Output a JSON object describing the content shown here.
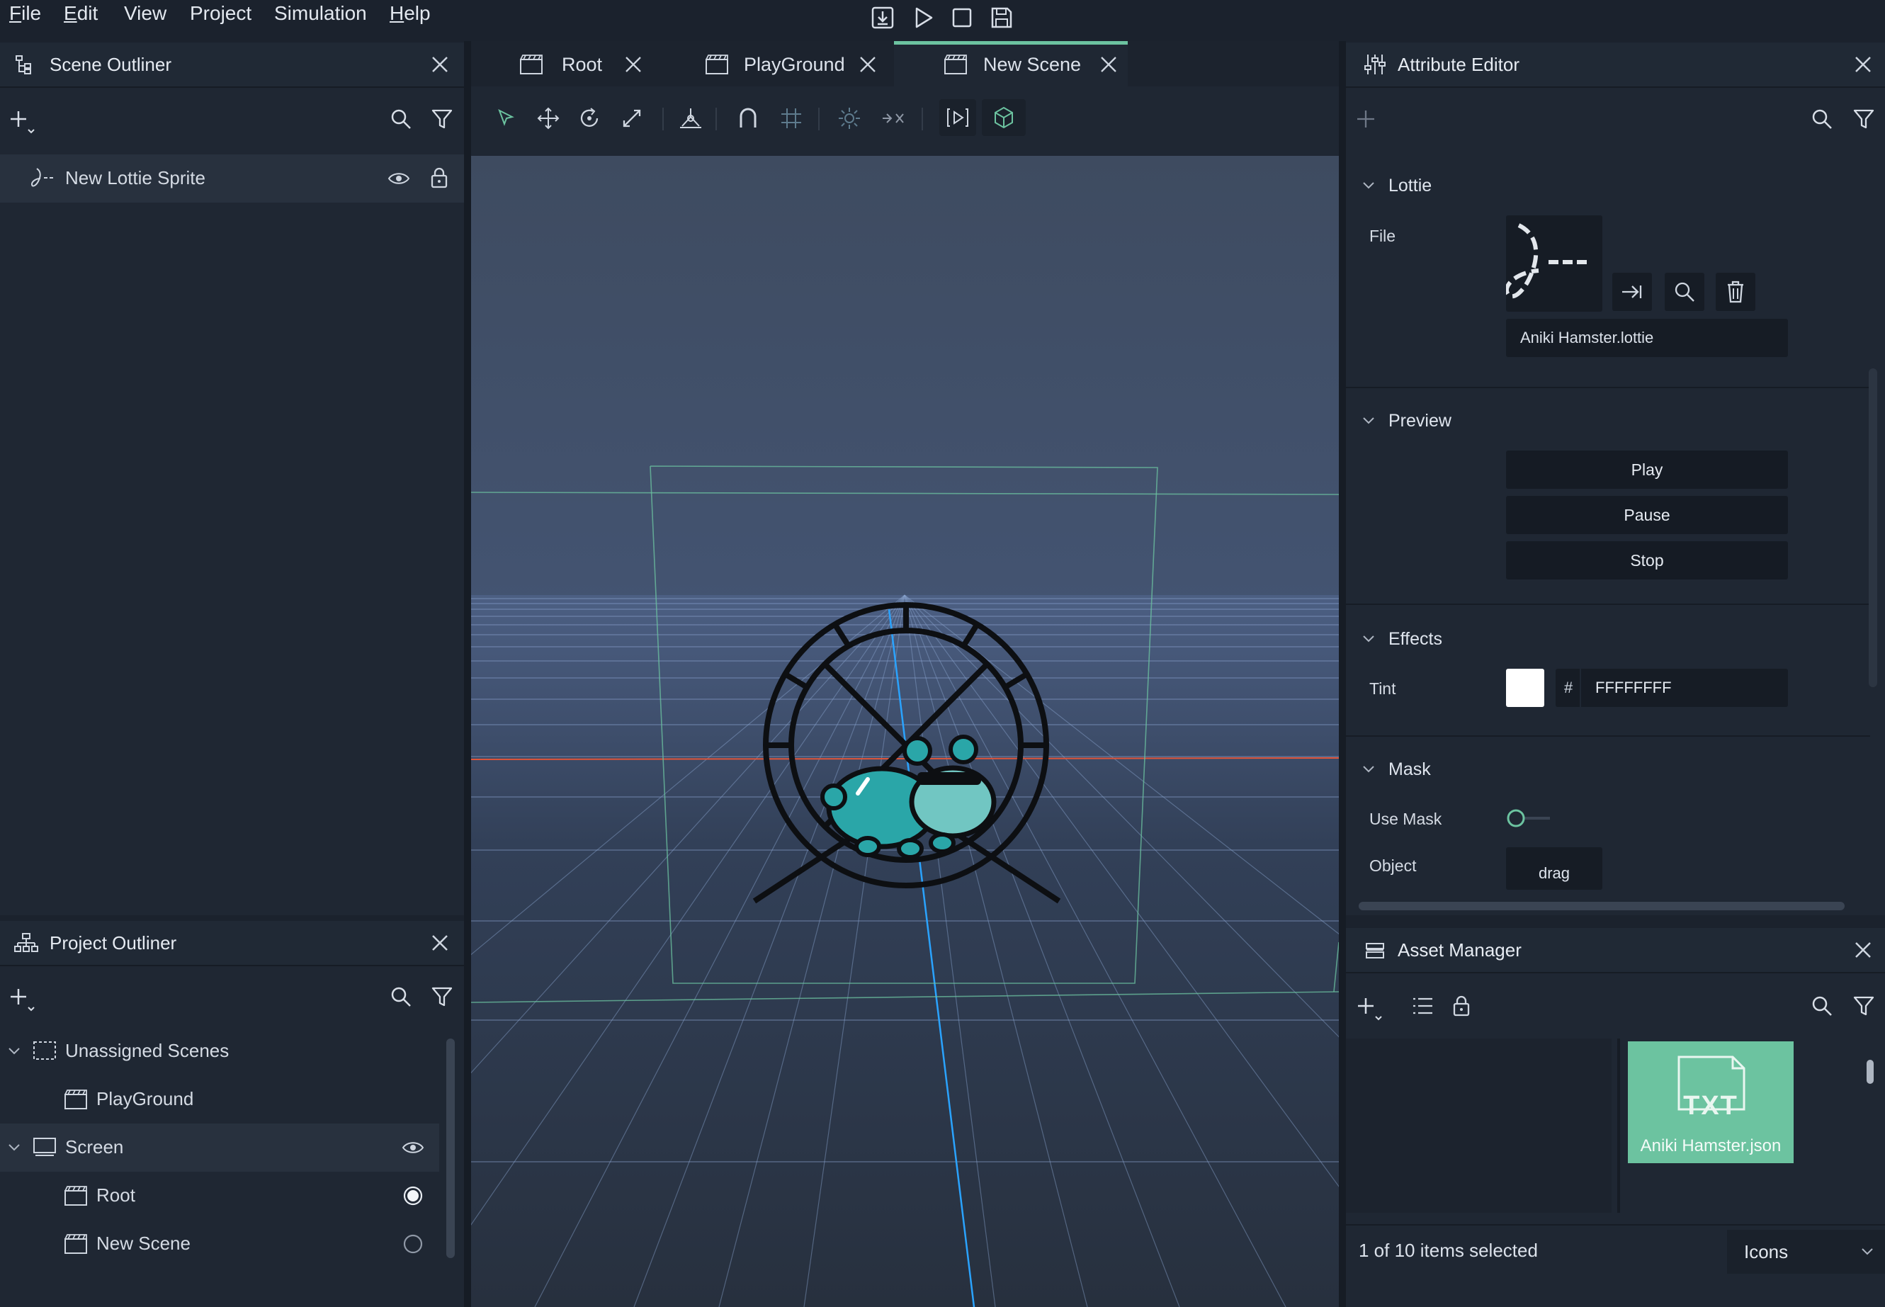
{
  "menubar": {
    "items": [
      "File",
      "Edit",
      "View",
      "Project",
      "Simulation",
      "Help"
    ]
  },
  "toolbar_icons": [
    "export-icon",
    "play-icon",
    "stop-icon",
    "save-icon"
  ],
  "scene_outliner": {
    "title": "Scene Outliner",
    "items": [
      {
        "label": "New Lottie Sprite"
      }
    ]
  },
  "project_outliner": {
    "title": "Project Outliner",
    "tree": [
      {
        "label": "Unassigned Scenes"
      },
      {
        "label": "PlayGround"
      },
      {
        "label": "Screen"
      },
      {
        "label": "Root",
        "selected": true
      },
      {
        "label": "New Scene",
        "selected": false
      }
    ]
  },
  "viewport": {
    "tabs": [
      {
        "label": "Root",
        "active": false
      },
      {
        "label": "PlayGround",
        "active": false
      },
      {
        "label": "New Scene",
        "active": true
      }
    ],
    "tools": [
      "select-tool",
      "move-tool",
      "rotate-tool",
      "scale-tool",
      "pivot-tool",
      "magnet-tool",
      "grid-tool",
      "light-tool",
      "transform-tool",
      "play-scene-tool",
      "3d-view-tool"
    ]
  },
  "attribute_editor": {
    "title": "Attribute Editor",
    "sections": {
      "lottie": "Lottie",
      "preview": "Preview",
      "effects": "Effects",
      "mask": "Mask"
    },
    "file_label": "File",
    "file_name": "Aniki Hamster.lottie",
    "preview_buttons": {
      "play": "Play",
      "pause": "Pause",
      "stop": "Stop"
    },
    "tint_label": "Tint",
    "tint_hash": "#",
    "tint_value": "FFFFFFFF",
    "use_mask_label": "Use Mask",
    "use_mask_on": false,
    "object_label": "Object",
    "object_placeholder": "drag"
  },
  "asset_manager": {
    "title": "Asset Manager",
    "asset": {
      "name": "Aniki Hamster.json",
      "type_badge": "TXT"
    },
    "status": "1 of 10 items selected",
    "view_mode": "Icons"
  },
  "colors": {
    "accent": "#6cc3a0",
    "background": "#1b222d",
    "panel": "#1f2733",
    "axis_red": "#e0553a",
    "axis_blue": "#2aa3ff"
  }
}
